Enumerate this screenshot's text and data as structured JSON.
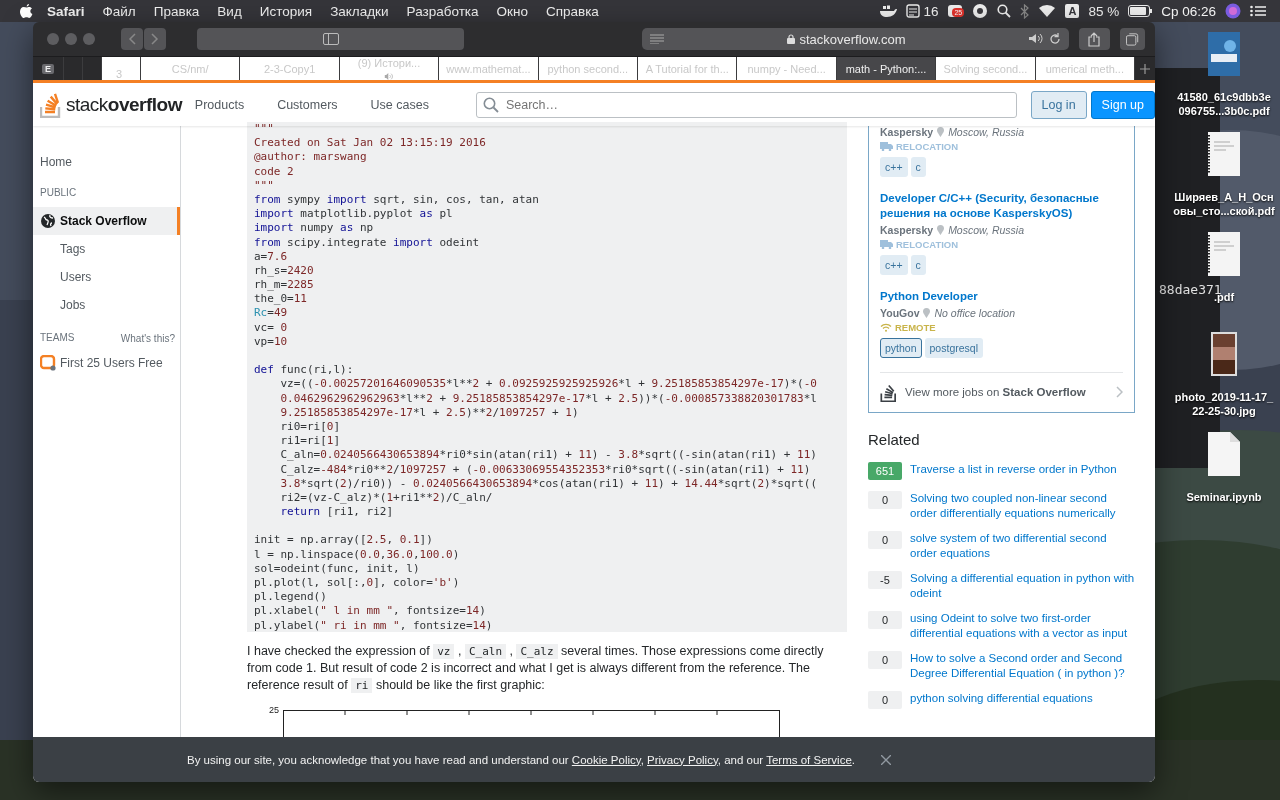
{
  "menu_bar": {
    "app": "Safari",
    "menus": [
      "Файл",
      "Правка",
      "Вид",
      "История",
      "Закладки",
      "Разработка",
      "Окно",
      "Справка"
    ],
    "status": {
      "count": "16",
      "badge": "25",
      "input_source": "A",
      "battery": "85 %",
      "clock": "Ср 06:26"
    }
  },
  "browser": {
    "address": "stackoverflow.com",
    "tabs": [
      {
        "kind": "pinned",
        "label": "E",
        "selected": false
      },
      {
        "kind": "blank",
        "selected": false
      },
      {
        "kind": "blank",
        "selected": false
      },
      {
        "kind": "page",
        "label": "3",
        "selected": false,
        "audio": false
      },
      {
        "kind": "page",
        "label": "CS/nm/",
        "selected": false,
        "audio": false
      },
      {
        "kind": "page",
        "label": "2-3-Copy1",
        "selected": false,
        "audio": false
      },
      {
        "kind": "page",
        "label": "(9) Истори...",
        "selected": false,
        "audio": true
      },
      {
        "kind": "page",
        "label": "www.mathemat...",
        "selected": false,
        "audio": false
      },
      {
        "kind": "page",
        "label": "python second...",
        "selected": false,
        "audio": false
      },
      {
        "kind": "page",
        "label": "A Tutorial for th...",
        "selected": false,
        "audio": false
      },
      {
        "kind": "page",
        "label": "numpy - Need...",
        "selected": false,
        "audio": false
      },
      {
        "kind": "page",
        "label": "math - Python:...",
        "selected": true,
        "audio": false
      },
      {
        "kind": "page",
        "label": "Solving second...",
        "selected": false,
        "audio": false
      },
      {
        "kind": "page",
        "label": "umerical meth...",
        "selected": false,
        "audio": false
      }
    ]
  },
  "header": {
    "logo": "stack**overflow**",
    "nav": [
      "Products",
      "Customers",
      "Use cases"
    ],
    "search_placeholder": "Search…",
    "login": "Log in",
    "signup": "Sign up"
  },
  "left_nav": {
    "home": {
      "label": "Home",
      "selected": false
    },
    "public_heading": "PUBLIC",
    "items": [
      {
        "kind": "site",
        "label": "Stack Overflow",
        "selected": true
      },
      {
        "kind": "sub",
        "label": "Tags",
        "selected": false
      },
      {
        "kind": "sub",
        "label": "Users",
        "selected": false
      },
      {
        "kind": "sub",
        "label": "Jobs",
        "selected": false
      }
    ],
    "teams_heading": "TEAMS",
    "teams_help": "What's this?",
    "teams_offer": "First 25 Users Free"
  },
  "question": {
    "code": [
      {
        "kind": "code",
        "segments": [
          {
            "kind": "str",
            "text": "\"\"\""
          }
        ]
      },
      {
        "kind": "code",
        "segments": [
          {
            "kind": "str",
            "text": "Created on Sat Jan 02 13:15:19 2016"
          }
        ]
      },
      {
        "kind": "code",
        "segments": [
          {
            "kind": "str",
            "text": "@author: marswang"
          }
        ]
      },
      {
        "kind": "code",
        "segments": [
          {
            "kind": "str",
            "text": "code 2"
          }
        ]
      },
      {
        "kind": "code",
        "segments": [
          {
            "kind": "str",
            "text": "\"\"\""
          }
        ]
      },
      {
        "kind": "code",
        "segments": [
          {
            "kind": "kw",
            "text": "from"
          },
          {
            "kind": "plain",
            "text": " sympy "
          },
          {
            "kind": "kw",
            "text": "import"
          },
          {
            "kind": "plain",
            "text": " sqrt, sin, cos, tan, atan"
          }
        ]
      },
      {
        "kind": "code",
        "segments": [
          {
            "kind": "kw",
            "text": "import"
          },
          {
            "kind": "plain",
            "text": " matplotlib.pyplot "
          },
          {
            "kind": "kw",
            "text": "as"
          },
          {
            "kind": "plain",
            "text": " pl"
          }
        ]
      },
      {
        "kind": "code",
        "segments": [
          {
            "kind": "kw",
            "text": "import"
          },
          {
            "kind": "plain",
            "text": " numpy "
          },
          {
            "kind": "kw",
            "text": "as"
          },
          {
            "kind": "plain",
            "text": " np"
          }
        ]
      },
      {
        "kind": "code",
        "segments": [
          {
            "kind": "kw",
            "text": "from"
          },
          {
            "kind": "plain",
            "text": " scipy.integrate "
          },
          {
            "kind": "kw",
            "text": "import"
          },
          {
            "kind": "plain",
            "text": " odeint"
          }
        ]
      },
      {
        "kind": "code",
        "segments": [
          {
            "kind": "plain",
            "text": "a="
          },
          {
            "kind": "num",
            "text": "7.6"
          }
        ]
      },
      {
        "kind": "code",
        "segments": [
          {
            "kind": "plain",
            "text": "rh_s="
          },
          {
            "kind": "num",
            "text": "2420"
          }
        ]
      },
      {
        "kind": "code",
        "segments": [
          {
            "kind": "plain",
            "text": "rh_m="
          },
          {
            "kind": "num",
            "text": "2285"
          }
        ]
      },
      {
        "kind": "code",
        "segments": [
          {
            "kind": "plain",
            "text": "the_0="
          },
          {
            "kind": "num",
            "text": "11"
          }
        ]
      },
      {
        "kind": "code",
        "segments": [
          {
            "kind": "lit",
            "text": "Rc"
          },
          {
            "kind": "plain",
            "text": "="
          },
          {
            "kind": "num",
            "text": "49"
          }
        ]
      },
      {
        "kind": "code",
        "segments": [
          {
            "kind": "plain",
            "text": "vc= "
          },
          {
            "kind": "num",
            "text": "0"
          }
        ]
      },
      {
        "kind": "code",
        "segments": [
          {
            "kind": "plain",
            "text": "vp="
          },
          {
            "kind": "num",
            "text": "10"
          }
        ]
      },
      {
        "kind": "blank"
      },
      {
        "kind": "code",
        "segments": [
          {
            "kind": "kw",
            "text": "def"
          },
          {
            "kind": "plain",
            "text": " func(ri,l):"
          }
        ]
      },
      {
        "kind": "code",
        "segments": [
          {
            "kind": "plain",
            "text": "    vz=(("
          },
          {
            "kind": "num",
            "text": "-0.00257201646090535"
          },
          {
            "kind": "plain",
            "text": "*l**"
          },
          {
            "kind": "num",
            "text": "2"
          },
          {
            "kind": "plain",
            "text": " + "
          },
          {
            "kind": "num",
            "text": "0.0925925925925926"
          },
          {
            "kind": "plain",
            "text": "*l + "
          },
          {
            "kind": "num",
            "text": "9.25185853854297e-17"
          },
          {
            "kind": "plain",
            "text": ")*("
          },
          {
            "kind": "num",
            "text": "-0"
          }
        ]
      },
      {
        "kind": "code",
        "segments": [
          {
            "kind": "num",
            "text": "    0.0462962962962963"
          },
          {
            "kind": "plain",
            "text": "*l**"
          },
          {
            "kind": "num",
            "text": "2"
          },
          {
            "kind": "plain",
            "text": " + "
          },
          {
            "kind": "num",
            "text": "9.25185853854297e-17"
          },
          {
            "kind": "plain",
            "text": "*l + "
          },
          {
            "kind": "num",
            "text": "2.5"
          },
          {
            "kind": "plain",
            "text": "))*("
          },
          {
            "kind": "num",
            "text": "-0.000857338820301783"
          },
          {
            "kind": "plain",
            "text": "*l"
          }
        ]
      },
      {
        "kind": "code",
        "segments": [
          {
            "kind": "num",
            "text": "    9.25185853854297e-17"
          },
          {
            "kind": "plain",
            "text": "*l + "
          },
          {
            "kind": "num",
            "text": "2.5"
          },
          {
            "kind": "plain",
            "text": ")**"
          },
          {
            "kind": "num",
            "text": "2"
          },
          {
            "kind": "plain",
            "text": "/"
          },
          {
            "kind": "num",
            "text": "1097257"
          },
          {
            "kind": "plain",
            "text": " + "
          },
          {
            "kind": "num",
            "text": "1"
          },
          {
            "kind": "plain",
            "text": ")"
          }
        ]
      },
      {
        "kind": "code",
        "segments": [
          {
            "kind": "plain",
            "text": "    ri0=ri["
          },
          {
            "kind": "num",
            "text": "0"
          },
          {
            "kind": "plain",
            "text": "]"
          }
        ]
      },
      {
        "kind": "code",
        "segments": [
          {
            "kind": "plain",
            "text": "    ri1=ri["
          },
          {
            "kind": "num",
            "text": "1"
          },
          {
            "kind": "plain",
            "text": "]"
          }
        ]
      },
      {
        "kind": "code",
        "segments": [
          {
            "kind": "plain",
            "text": "    C_aln="
          },
          {
            "kind": "num",
            "text": "0.0240566430653894"
          },
          {
            "kind": "plain",
            "text": "*ri0*sin(atan(ri1) + "
          },
          {
            "kind": "num",
            "text": "11"
          },
          {
            "kind": "plain",
            "text": ") - "
          },
          {
            "kind": "num",
            "text": "3.8"
          },
          {
            "kind": "plain",
            "text": "*sqrt((-sin(atan(ri1) + "
          },
          {
            "kind": "num",
            "text": "11"
          },
          {
            "kind": "plain",
            "text": ")"
          }
        ]
      },
      {
        "kind": "code",
        "segments": [
          {
            "kind": "plain",
            "text": "    C_alz="
          },
          {
            "kind": "num",
            "text": "-484"
          },
          {
            "kind": "plain",
            "text": "*ri0**"
          },
          {
            "kind": "num",
            "text": "2"
          },
          {
            "kind": "plain",
            "text": "/"
          },
          {
            "kind": "num",
            "text": "1097257"
          },
          {
            "kind": "plain",
            "text": " + ("
          },
          {
            "kind": "num",
            "text": "-0.00633069554352353"
          },
          {
            "kind": "plain",
            "text": "*ri0*sqrt((-sin(atan(ri1) + "
          },
          {
            "kind": "num",
            "text": "11"
          },
          {
            "kind": "plain",
            "text": ")"
          }
        ]
      },
      {
        "kind": "code",
        "segments": [
          {
            "kind": "num",
            "text": "    3.8"
          },
          {
            "kind": "plain",
            "text": "*sqrt("
          },
          {
            "kind": "num",
            "text": "2"
          },
          {
            "kind": "plain",
            "text": ")/ri0)) - "
          },
          {
            "kind": "num",
            "text": "0.0240566430653894"
          },
          {
            "kind": "plain",
            "text": "*cos(atan(ri1) + "
          },
          {
            "kind": "num",
            "text": "11"
          },
          {
            "kind": "plain",
            "text": ") + "
          },
          {
            "kind": "num",
            "text": "14.44"
          },
          {
            "kind": "plain",
            "text": "*sqrt("
          },
          {
            "kind": "num",
            "text": "2"
          },
          {
            "kind": "plain",
            "text": ")*sqrt(("
          }
        ]
      },
      {
        "kind": "code",
        "segments": [
          {
            "kind": "plain",
            "text": "    ri2=(vz-C_alz)*("
          },
          {
            "kind": "num",
            "text": "1"
          },
          {
            "kind": "plain",
            "text": "+ri1**"
          },
          {
            "kind": "num",
            "text": "2"
          },
          {
            "kind": "plain",
            "text": ")/C_aln/"
          }
        ]
      },
      {
        "kind": "code",
        "segments": [
          {
            "kind": "kw",
            "text": "    return"
          },
          {
            "kind": "plain",
            "text": " [ri1, ri2]"
          }
        ]
      },
      {
        "kind": "blank"
      },
      {
        "kind": "code",
        "segments": [
          {
            "kind": "plain",
            "text": "init = np.array(["
          },
          {
            "kind": "num",
            "text": "2.5"
          },
          {
            "kind": "plain",
            "text": ", "
          },
          {
            "kind": "num",
            "text": "0.1"
          },
          {
            "kind": "plain",
            "text": "])"
          }
        ]
      },
      {
        "kind": "code",
        "segments": [
          {
            "kind": "plain",
            "text": "l = np.linspace("
          },
          {
            "kind": "num",
            "text": "0.0"
          },
          {
            "kind": "plain",
            "text": ","
          },
          {
            "kind": "num",
            "text": "36.0"
          },
          {
            "kind": "plain",
            "text": ","
          },
          {
            "kind": "num",
            "text": "100.0"
          },
          {
            "kind": "plain",
            "text": ")"
          }
        ]
      },
      {
        "kind": "code",
        "segments": [
          {
            "kind": "plain",
            "text": "sol=odeint(func, init, l)"
          }
        ]
      },
      {
        "kind": "code",
        "segments": [
          {
            "kind": "plain",
            "text": "pl.plot(l, sol[:,"
          },
          {
            "kind": "num",
            "text": "0"
          },
          {
            "kind": "plain",
            "text": "], color="
          },
          {
            "kind": "str",
            "text": "'b'"
          },
          {
            "kind": "plain",
            "text": ")"
          }
        ]
      },
      {
        "kind": "code",
        "segments": [
          {
            "kind": "plain",
            "text": "pl.legend()"
          }
        ]
      },
      {
        "kind": "code",
        "segments": [
          {
            "kind": "plain",
            "text": "pl.xlabel("
          },
          {
            "kind": "str",
            "text": "\" l in mm \""
          },
          {
            "kind": "plain",
            "text": ", fontsize="
          },
          {
            "kind": "num",
            "text": "14"
          },
          {
            "kind": "plain",
            "text": ")"
          }
        ]
      },
      {
        "kind": "code",
        "segments": [
          {
            "kind": "plain",
            "text": "pl.ylabel("
          },
          {
            "kind": "str",
            "text": "\" ri in mm \""
          },
          {
            "kind": "plain",
            "text": ", fontsize="
          },
          {
            "kind": "num",
            "text": "14"
          },
          {
            "kind": "plain",
            "text": ")"
          }
        ]
      }
    ],
    "paragraph": [
      {
        "kind": "text",
        "text": "I have checked the expression of "
      },
      {
        "kind": "code",
        "text": "vz"
      },
      {
        "kind": "text",
        "text": " , "
      },
      {
        "kind": "code",
        "text": "C_aln"
      },
      {
        "kind": "text",
        "text": " , "
      },
      {
        "kind": "code",
        "text": "C_alz"
      },
      {
        "kind": "text",
        "text": " several times. Those expressions come directly from code 1. But result of code 2 is incorrect and what I get is always different from the reference. The reference result of "
      },
      {
        "kind": "code",
        "text": "ri"
      },
      {
        "kind": "text",
        "text": " should be like the first graphic:"
      }
    ],
    "graphic": {
      "top_tick": "25"
    }
  },
  "jobs": [
    {
      "company": "Kaspersky",
      "location": "Moscow, Russia",
      "perk": {
        "kind": "relocation",
        "label": "RELOCATION"
      },
      "tags": [
        {
          "label": "c++",
          "watched": false
        },
        {
          "label": "c",
          "watched": false
        }
      ]
    },
    {
      "title": "Developer C/C++ (Security, безопасные решения на основе KasperskyOS)",
      "company": "Kaspersky",
      "location": "Moscow, Russia",
      "perk": {
        "kind": "relocation",
        "label": "RELOCATION"
      },
      "tags": [
        {
          "label": "c++",
          "watched": false
        },
        {
          "label": "c",
          "watched": false
        }
      ]
    },
    {
      "title": "Python Developer",
      "company": "YouGov",
      "location": "No office location",
      "perk": {
        "kind": "remote",
        "label": "REMOTE"
      },
      "tags": [
        {
          "label": "python",
          "watched": true
        },
        {
          "label": "postgresql",
          "watched": false
        }
      ]
    }
  ],
  "jobs_footer": "View more jobs on **Stack Overflow**",
  "related": {
    "heading": "Related",
    "items": [
      {
        "score": "651",
        "answered": true,
        "title": "Traverse a list in reverse order in Python"
      },
      {
        "score": "0",
        "answered": false,
        "title": "Solving two coupled non-linear second order differentially equations numerically"
      },
      {
        "score": "0",
        "answered": false,
        "title": "solve system of two differential second order equations"
      },
      {
        "score": "-5",
        "answered": false,
        "title": "Solving a differential equation in python with odeint"
      },
      {
        "score": "0",
        "answered": false,
        "title": "using Odeint to solve two first-order differential equations with a vector as input"
      },
      {
        "score": "0",
        "answered": false,
        "title": "How to solve a Second order and Second Degree Differential Equation ( in python )?"
      },
      {
        "score": "0",
        "answered": false,
        "title": "python solving differential equations"
      }
    ]
  },
  "cookie_notice": [
    {
      "kind": "text",
      "text": "By using our site, you acknowledge that you have read and understand our "
    },
    {
      "kind": "link",
      "text": "Cookie Policy"
    },
    {
      "kind": "text",
      "text": ", "
    },
    {
      "kind": "link",
      "text": "Privacy Policy"
    },
    {
      "kind": "text",
      "text": ", and our "
    },
    {
      "kind": "link",
      "text": "Terms of Service"
    },
    {
      "kind": "text",
      "text": "."
    }
  ],
  "desktop": {
    "window_text": "88dae371",
    "files": [
      {
        "kind": "cover",
        "lines": [
          "41580_61c9dbb3e",
          "096755...3b0c.pdf"
        ]
      },
      {
        "kind": "document",
        "lines": [
          "Ширяев_А_Н_Осн",
          "овы_сто...ской.pdf"
        ]
      },
      {
        "kind": "document",
        "lines": [
          ".pdf"
        ]
      },
      {
        "lines": [
          "photo_2019-11-17_",
          "22-25-30.jpg"
        ]
      },
      {
        "kind": "file",
        "lines": [
          "Seminar.ipynb"
        ]
      }
    ]
  }
}
